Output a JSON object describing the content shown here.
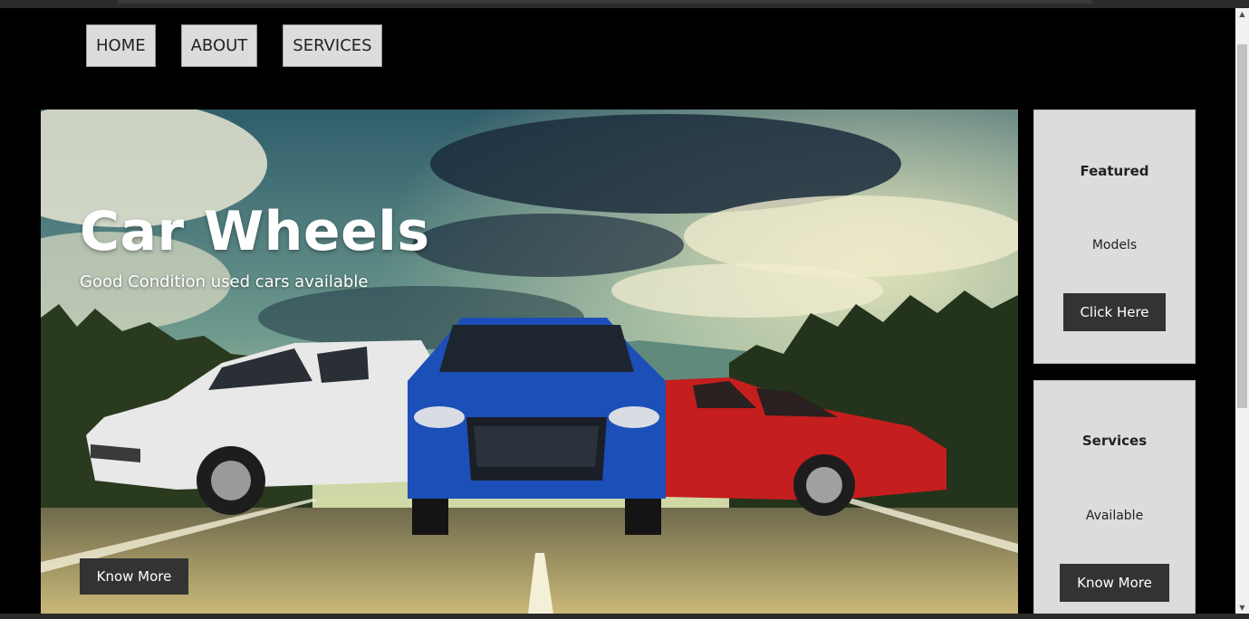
{
  "nav": {
    "items": [
      {
        "label": "HOME"
      },
      {
        "label": "ABOUT"
      },
      {
        "label": "SERVICES"
      }
    ]
  },
  "hero": {
    "title": "Car Wheels",
    "subtitle": "Good Condition used cars available",
    "button_label": "Know More"
  },
  "cards": [
    {
      "title": "Featured",
      "text": "Models",
      "button_label": "Click Here"
    },
    {
      "title": "Services",
      "text": "Available",
      "button_label": "Know More"
    }
  ],
  "icons": {
    "scroll_up": "triangle-up-icon",
    "scroll_down": "triangle-down-icon"
  },
  "colors": {
    "page_background": "#000000",
    "nav_button": "#dcdcdc",
    "card_background": "#dcdcdc",
    "dark_button": "#333333",
    "car_white": "#e8e8e8",
    "car_blue": "#1d4fb8",
    "car_red": "#c41e1e"
  }
}
